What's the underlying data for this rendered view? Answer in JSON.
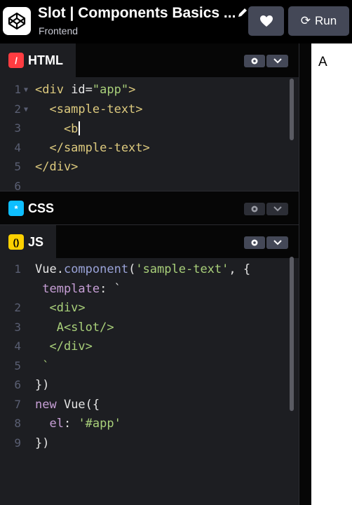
{
  "header": {
    "title": "Slot | Components Basics ...",
    "subtitle": "Frontend",
    "run_label": "Run",
    "run_icon_char": "⟳"
  },
  "panes": {
    "html": {
      "label": "HTML",
      "icon": "/"
    },
    "css": {
      "label": "CSS",
      "icon": "*"
    },
    "js": {
      "label": "JS",
      "icon": "()"
    }
  },
  "html_code": [
    {
      "n": "1",
      "parts": [
        [
          "t-tag",
          "<div "
        ],
        [
          "t-attr",
          "id"
        ],
        [
          "t-plain",
          "="
        ],
        [
          "t-str",
          "\"app\""
        ],
        [
          "t-tag",
          ">"
        ]
      ]
    },
    {
      "n": "2",
      "parts": [
        [
          "t-tag",
          "  <sample-text>"
        ]
      ]
    },
    {
      "n": "3",
      "parts": [
        [
          "t-tag",
          "    <b"
        ]
      ]
    },
    {
      "n": "4",
      "parts": [
        [
          "t-tag",
          "  </sample-text>"
        ]
      ]
    },
    {
      "n": "5",
      "parts": [
        [
          "t-tag",
          "</div>"
        ]
      ]
    },
    {
      "n": "6",
      "parts": []
    }
  ],
  "js_code": [
    {
      "n": "1",
      "parts": [
        [
          "t-plain",
          "Vue."
        ],
        [
          "t-fn",
          "component"
        ],
        [
          "t-plain",
          "("
        ],
        [
          "t-str",
          "'sample-text'"
        ],
        [
          "t-plain",
          ", {"
        ]
      ]
    },
    {
      "n": "",
      "parts": [
        [
          "t-key",
          " template"
        ],
        [
          "t-plain",
          ": `"
        ]
      ]
    },
    {
      "n": "2",
      "parts": [
        [
          "t-str",
          "  <div>"
        ]
      ]
    },
    {
      "n": "3",
      "parts": [
        [
          "t-str",
          "   A<slot/>"
        ]
      ]
    },
    {
      "n": "4",
      "parts": [
        [
          "t-str",
          "  </div>"
        ]
      ]
    },
    {
      "n": "5",
      "parts": [
        [
          "t-str",
          " `"
        ]
      ]
    },
    {
      "n": "6",
      "parts": [
        [
          "t-plain",
          "})"
        ]
      ]
    },
    {
      "n": "7",
      "parts": [
        [
          "t-key",
          "new "
        ],
        [
          "t-plain",
          "Vue({"
        ]
      ]
    },
    {
      "n": "8",
      "parts": [
        [
          "t-key",
          "  el"
        ],
        [
          "t-plain",
          ": "
        ],
        [
          "t-str",
          "'#app'"
        ]
      ]
    },
    {
      "n": "9",
      "parts": [
        [
          "t-plain",
          "})"
        ]
      ]
    }
  ],
  "preview": {
    "text": "A"
  }
}
